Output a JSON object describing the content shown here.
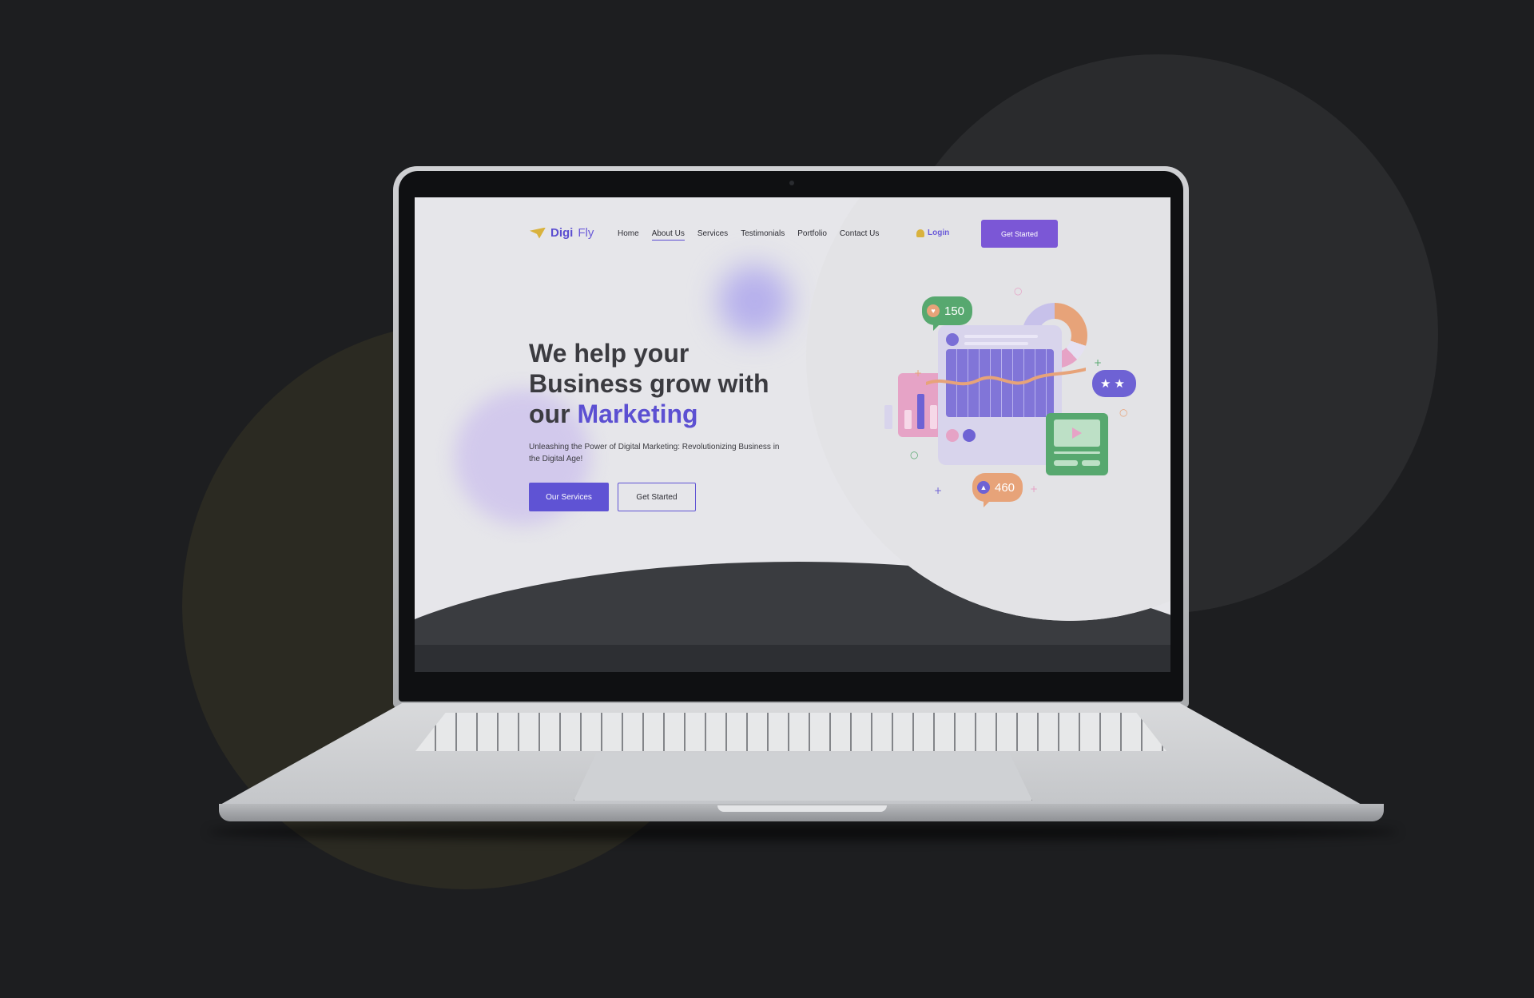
{
  "brand": {
    "name_part1": "Digi",
    "name_part2": "Fly"
  },
  "nav": {
    "items": [
      {
        "label": "Home"
      },
      {
        "label": "About Us",
        "active": true
      },
      {
        "label": "Services"
      },
      {
        "label": "Testimonials"
      },
      {
        "label": "Portfolio"
      },
      {
        "label": "Contact Us"
      }
    ],
    "login_label": "Login",
    "cta_label": "Get Started"
  },
  "hero": {
    "headline_line1": "We help your",
    "headline_line2": "Business grow with",
    "headline_line3_prefix": "our",
    "headline_accent": "Marketing",
    "subtitle": "Unleashing the Power of Digital Marketing: Revolutionizing Business in the Digital Age!",
    "primary_button": "Our Services",
    "secondary_button": "Get Started"
  },
  "illustration": {
    "likes_count": "150",
    "thumbs_count": "460",
    "rating_stars": "★★",
    "icons": [
      "heart-icon",
      "thumbs-up-icon",
      "play-icon",
      "user-icon",
      "chat-icon"
    ]
  },
  "colors": {
    "accent": "#5c50d2",
    "cta": "#7b57d6",
    "logo_plane": "#d9b23d",
    "background": "#1d1e20"
  }
}
